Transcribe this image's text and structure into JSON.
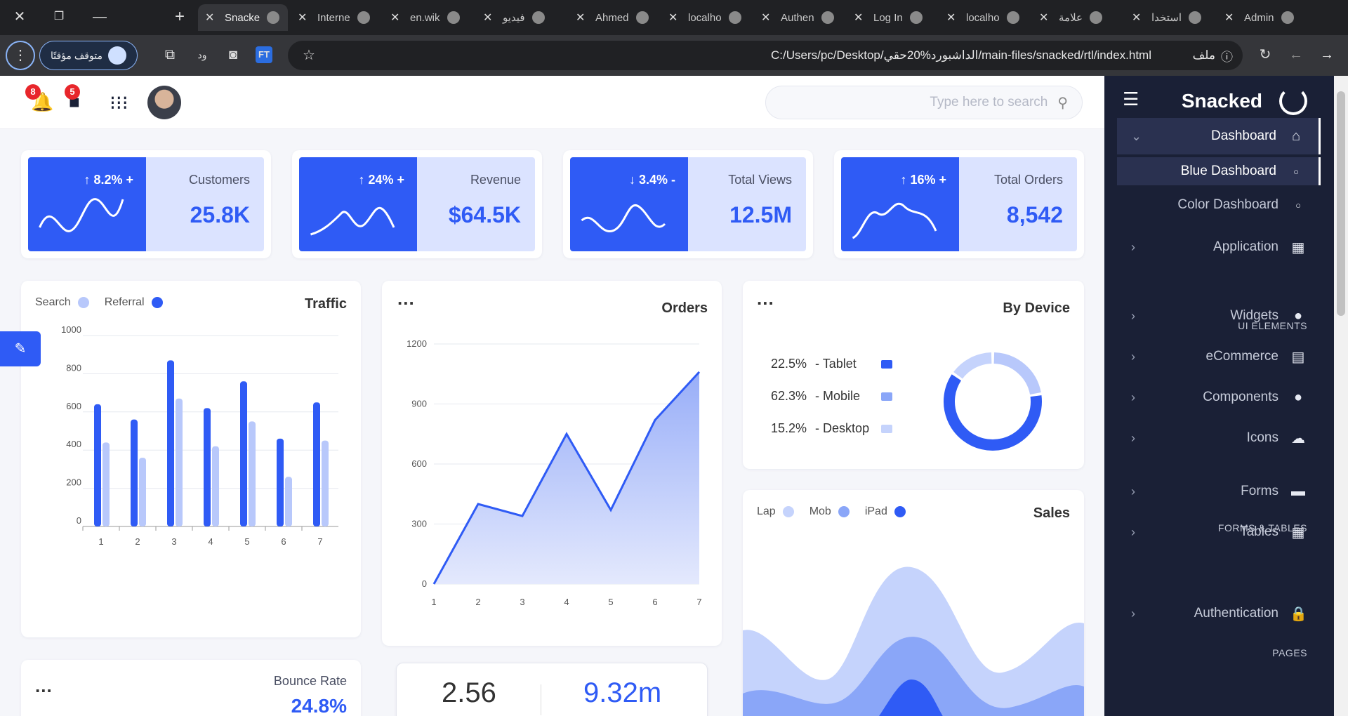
{
  "browser": {
    "tabs": [
      {
        "label": "Snacke",
        "active": true
      },
      {
        "label": "Interne"
      },
      {
        "label": "en.wik"
      },
      {
        "label": "فيديو"
      },
      {
        "label": "Ahmed"
      },
      {
        "label": "localho"
      },
      {
        "label": "Authen"
      },
      {
        "label": "Log In"
      },
      {
        "label": "localho"
      },
      {
        "label": "علامة"
      },
      {
        "label": "استخدا"
      },
      {
        "label": "Admin"
      }
    ],
    "profile_status": "متوقف مؤقتًا",
    "url": "C:/Users/pc/Desktop/الداشبورد%20حقي/main-files/snacked/rtl/index.html",
    "url_badge": "ملف",
    "ext_label": "FT",
    "ext_text": "ود"
  },
  "header": {
    "notifications_count": "8",
    "messages_count": "5",
    "search_placeholder": "Type here to search"
  },
  "sidebar": {
    "brand": "Snacked",
    "items": [
      {
        "label": "Dashboard",
        "icon": "home-icon"
      },
      {
        "label": "Blue Dashboard"
      },
      {
        "label": "Color Dashboard"
      },
      {
        "label": "Application",
        "icon": "grid-icon"
      },
      {
        "label": "Widgets",
        "icon": "drop-icon"
      },
      {
        "label": "eCommerce",
        "icon": "basket-icon"
      },
      {
        "label": "Components",
        "icon": "badge-icon"
      },
      {
        "label": "Icons",
        "icon": "cloud-icon"
      },
      {
        "label": "Forms",
        "icon": "form-icon"
      },
      {
        "label": "Tables",
        "icon": "table-icon"
      },
      {
        "label": "Authentication",
        "icon": "lock-icon"
      }
    ],
    "headings": [
      "UI ELEMENTS",
      "FORMS & TABLES",
      "PAGES"
    ]
  },
  "stats": [
    {
      "pct": "↑ 8.2% +",
      "label": "Customers",
      "value": "25.8K"
    },
    {
      "pct": "↑ 24% +",
      "label": "Revenue",
      "value": "$64.5K"
    },
    {
      "pct": "↓ 3.4% -",
      "label": "Total Views",
      "value": "12.5M"
    },
    {
      "pct": "↑ 16% +",
      "label": "Total Orders",
      "value": "8,542"
    }
  ],
  "traffic": {
    "title": "Traffic",
    "legend": [
      "Search",
      "Referral"
    ]
  },
  "orders": {
    "title": "Orders"
  },
  "device": {
    "title": "By Device",
    "rows": [
      {
        "pct": "22.5%",
        "label": "- Tablet"
      },
      {
        "pct": "62.3%",
        "label": "- Mobile"
      },
      {
        "pct": "15.2%",
        "label": "- Desktop"
      }
    ]
  },
  "sales": {
    "title": "Sales",
    "legend": [
      "Lap",
      "Mob",
      "iPad"
    ]
  },
  "bounce": {
    "label": "Bounce Rate",
    "value": "24.8%"
  },
  "mini_stats": {
    "left": "2.56",
    "right": "9.32m"
  },
  "colors": {
    "primary": "#2f5bf5",
    "light": "#b8c8fb",
    "sidebar": "#1a2036"
  },
  "chart_data": [
    {
      "type": "bar",
      "title": "Traffic",
      "categories": [
        "1",
        "2",
        "3",
        "4",
        "5",
        "6",
        "7"
      ],
      "series": [
        {
          "name": "Referral",
          "values": [
            640,
            560,
            870,
            620,
            760,
            460,
            650
          ]
        },
        {
          "name": "Search",
          "values": [
            440,
            360,
            670,
            420,
            550,
            260,
            450
          ]
        }
      ],
      "ylim": [
        0,
        1000
      ],
      "yticks": [
        0,
        200,
        400,
        600,
        800,
        1000
      ]
    },
    {
      "type": "area",
      "title": "Orders",
      "x": [
        "1",
        "2",
        "3",
        "4",
        "5",
        "6",
        "7"
      ],
      "values": [
        0,
        400,
        340,
        750,
        370,
        820,
        1060
      ],
      "ylim": [
        0,
        1200
      ],
      "yticks": [
        0,
        300,
        600,
        900,
        1200
      ]
    },
    {
      "type": "pie",
      "title": "By Device",
      "categories": [
        "Tablet",
        "Mobile",
        "Desktop"
      ],
      "values": [
        22.5,
        62.3,
        15.2
      ]
    }
  ]
}
